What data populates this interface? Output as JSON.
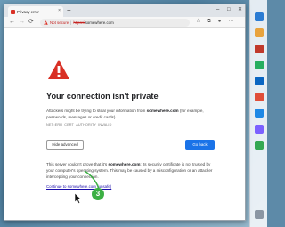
{
  "browser": {
    "tab_title": "Privacy error",
    "tab_close": "×",
    "new_tab": "+",
    "window_controls": {
      "minimize": "–",
      "maximize": "□",
      "close": "✕"
    },
    "nav": {
      "back": "←",
      "forward": "→",
      "refresh": "⟳"
    },
    "address": {
      "warning_label": "Not secure",
      "separator": "|",
      "scheme": "https://",
      "host": "somewhere.com"
    },
    "toolbar_icons": [
      "star-icon",
      "collections-icon",
      "profile-icon",
      "more-icon"
    ]
  },
  "error_page": {
    "title": "Your connection isn't private",
    "desc_prefix": "Attackers might be trying to steal your information from ",
    "desc_host": "somewhere.com",
    "desc_suffix": " (for example, passwords, messages or credit cards).",
    "error_code": "NET::ERR_CERT_AUTHORITY_INVALID",
    "hide_advanced_label": "Hide advanced",
    "go_back_label": "Go back",
    "advanced_prefix": "This server couldn't prove that it's ",
    "advanced_host": "somewhere.com",
    "advanced_suffix": "; its security certificate is not trusted by your computer's operating system. This may be caused by a misconfiguration or an attacker intercepting your connection.",
    "proceed_link": "Continue to somewhere.com (unsafe)"
  },
  "annotation": {
    "step_number": "3"
  },
  "colors": {
    "accent": "#1a73e8",
    "error_red": "#d93025",
    "step_green": "#3cb043"
  }
}
